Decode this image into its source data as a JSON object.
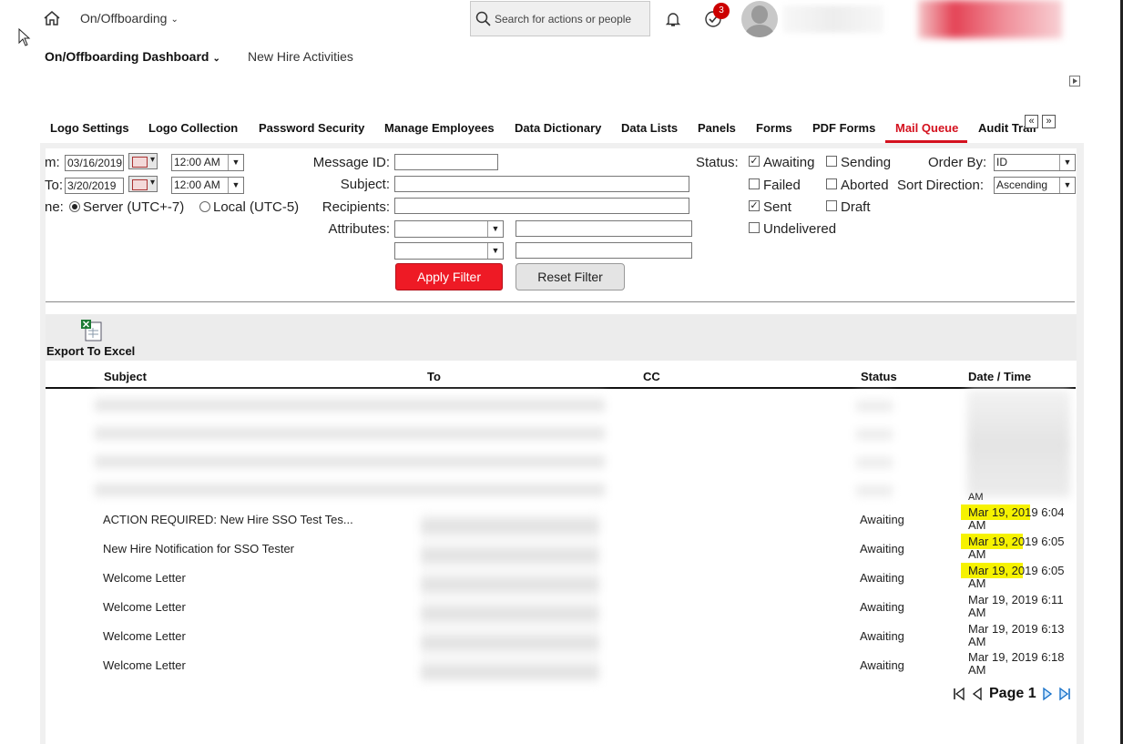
{
  "topbar": {
    "app_name": "On/Offboarding",
    "search_placeholder": "Search for actions or people",
    "todo_count": "3"
  },
  "subnav": {
    "dashboard": "On/Offboarding Dashboard",
    "new_hire": "New Hire Activities"
  },
  "tabs": [
    {
      "label": "Logo Settings"
    },
    {
      "label": "Logo Collection"
    },
    {
      "label": "Password Security"
    },
    {
      "label": "Manage Employees"
    },
    {
      "label": "Data Dictionary"
    },
    {
      "label": "Data Lists"
    },
    {
      "label": "Panels"
    },
    {
      "label": "Forms"
    },
    {
      "label": "PDF Forms"
    },
    {
      "label": "Mail Queue",
      "active": true
    },
    {
      "label": "Audit Trail"
    }
  ],
  "tab_nav": {
    "prev": "«",
    "next": "»"
  },
  "filter": {
    "from_label": "m:",
    "from_date": "03/16/2019",
    "from_time": "12:00 AM",
    "to_label": "To:",
    "to_date": "3/20/2019",
    "to_time": "12:00 AM",
    "timezone_label": "ne:",
    "tz_server": "Server (UTC+-7)",
    "tz_local": "Local (UTC-5)",
    "message_id_label": "Message ID:",
    "subject_label": "Subject:",
    "recipients_label": "Recipients:",
    "attributes_label": "Attributes:",
    "status_label": "Status:",
    "status_options": [
      {
        "label": "Awaiting",
        "checked": true
      },
      {
        "label": "Sending",
        "checked": false
      },
      {
        "label": "Failed",
        "checked": false
      },
      {
        "label": "Aborted",
        "checked": false
      },
      {
        "label": "Sent",
        "checked": true
      },
      {
        "label": "Draft",
        "checked": false
      },
      {
        "label": "Undelivered",
        "checked": false
      }
    ],
    "order_by_label": "Order By:",
    "order_by_value": "ID",
    "sort_dir_label": "Sort Direction:",
    "sort_dir_value": "Ascending",
    "apply_label": "Apply Filter",
    "reset_label": "Reset Filter"
  },
  "export_label": "Export To Excel",
  "table": {
    "headers": [
      "Subject",
      "To",
      "CC",
      "Status",
      "Date / Time"
    ],
    "rows": [
      {
        "subject": "ACTION REQUIRED: New Hire SSO Test Tes...",
        "status": "Awaiting",
        "date1": "Mar 19, 2019 6:04",
        "date2": "AM",
        "highlight": true
      },
      {
        "subject": "New Hire Notification for SSO Tester",
        "status": "Awaiting",
        "date1": "Mar 19, 2019 6:05",
        "date2": "AM",
        "highlight": true
      },
      {
        "subject": "Welcome Letter",
        "status": "Awaiting",
        "date1": "Mar 19, 2019 6:05",
        "date2": "AM",
        "highlight": true
      },
      {
        "subject": "Welcome Letter",
        "status": "Awaiting",
        "date1": "Mar 19, 2019 6:11",
        "date2": "AM",
        "highlight": false
      },
      {
        "subject": "Welcome Letter",
        "status": "Awaiting",
        "date1": "Mar 19, 2019 6:13",
        "date2": "AM",
        "highlight": false
      },
      {
        "subject": "Welcome Letter",
        "status": "Awaiting",
        "date1": "Mar 19, 2019 6:18",
        "date2": "AM",
        "highlight": false
      }
    ],
    "partial_top_date_tail": "AM"
  },
  "pager": {
    "label": "Page 1"
  },
  "colors": {
    "accent": "#d4111e",
    "apply": "#ee1a25",
    "highlight": "#f6f200"
  }
}
